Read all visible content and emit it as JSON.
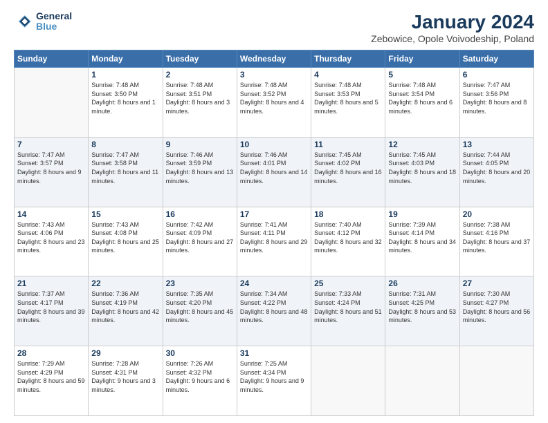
{
  "header": {
    "logo_line1": "General",
    "logo_line2": "Blue",
    "title": "January 2024",
    "subtitle": "Zebowice, Opole Voivodeship, Poland"
  },
  "weekdays": [
    "Sunday",
    "Monday",
    "Tuesday",
    "Wednesday",
    "Thursday",
    "Friday",
    "Saturday"
  ],
  "weeks": [
    [
      {
        "day": "",
        "sunrise": "",
        "sunset": "",
        "daylight": ""
      },
      {
        "day": "1",
        "sunrise": "Sunrise: 7:48 AM",
        "sunset": "Sunset: 3:50 PM",
        "daylight": "Daylight: 8 hours and 1 minute."
      },
      {
        "day": "2",
        "sunrise": "Sunrise: 7:48 AM",
        "sunset": "Sunset: 3:51 PM",
        "daylight": "Daylight: 8 hours and 3 minutes."
      },
      {
        "day": "3",
        "sunrise": "Sunrise: 7:48 AM",
        "sunset": "Sunset: 3:52 PM",
        "daylight": "Daylight: 8 hours and 4 minutes."
      },
      {
        "day": "4",
        "sunrise": "Sunrise: 7:48 AM",
        "sunset": "Sunset: 3:53 PM",
        "daylight": "Daylight: 8 hours and 5 minutes."
      },
      {
        "day": "5",
        "sunrise": "Sunrise: 7:48 AM",
        "sunset": "Sunset: 3:54 PM",
        "daylight": "Daylight: 8 hours and 6 minutes."
      },
      {
        "day": "6",
        "sunrise": "Sunrise: 7:47 AM",
        "sunset": "Sunset: 3:56 PM",
        "daylight": "Daylight: 8 hours and 8 minutes."
      }
    ],
    [
      {
        "day": "7",
        "sunrise": "Sunrise: 7:47 AM",
        "sunset": "Sunset: 3:57 PM",
        "daylight": "Daylight: 8 hours and 9 minutes."
      },
      {
        "day": "8",
        "sunrise": "Sunrise: 7:47 AM",
        "sunset": "Sunset: 3:58 PM",
        "daylight": "Daylight: 8 hours and 11 minutes."
      },
      {
        "day": "9",
        "sunrise": "Sunrise: 7:46 AM",
        "sunset": "Sunset: 3:59 PM",
        "daylight": "Daylight: 8 hours and 13 minutes."
      },
      {
        "day": "10",
        "sunrise": "Sunrise: 7:46 AM",
        "sunset": "Sunset: 4:01 PM",
        "daylight": "Daylight: 8 hours and 14 minutes."
      },
      {
        "day": "11",
        "sunrise": "Sunrise: 7:45 AM",
        "sunset": "Sunset: 4:02 PM",
        "daylight": "Daylight: 8 hours and 16 minutes."
      },
      {
        "day": "12",
        "sunrise": "Sunrise: 7:45 AM",
        "sunset": "Sunset: 4:03 PM",
        "daylight": "Daylight: 8 hours and 18 minutes."
      },
      {
        "day": "13",
        "sunrise": "Sunrise: 7:44 AM",
        "sunset": "Sunset: 4:05 PM",
        "daylight": "Daylight: 8 hours and 20 minutes."
      }
    ],
    [
      {
        "day": "14",
        "sunrise": "Sunrise: 7:43 AM",
        "sunset": "Sunset: 4:06 PM",
        "daylight": "Daylight: 8 hours and 23 minutes."
      },
      {
        "day": "15",
        "sunrise": "Sunrise: 7:43 AM",
        "sunset": "Sunset: 4:08 PM",
        "daylight": "Daylight: 8 hours and 25 minutes."
      },
      {
        "day": "16",
        "sunrise": "Sunrise: 7:42 AM",
        "sunset": "Sunset: 4:09 PM",
        "daylight": "Daylight: 8 hours and 27 minutes."
      },
      {
        "day": "17",
        "sunrise": "Sunrise: 7:41 AM",
        "sunset": "Sunset: 4:11 PM",
        "daylight": "Daylight: 8 hours and 29 minutes."
      },
      {
        "day": "18",
        "sunrise": "Sunrise: 7:40 AM",
        "sunset": "Sunset: 4:12 PM",
        "daylight": "Daylight: 8 hours and 32 minutes."
      },
      {
        "day": "19",
        "sunrise": "Sunrise: 7:39 AM",
        "sunset": "Sunset: 4:14 PM",
        "daylight": "Daylight: 8 hours and 34 minutes."
      },
      {
        "day": "20",
        "sunrise": "Sunrise: 7:38 AM",
        "sunset": "Sunset: 4:16 PM",
        "daylight": "Daylight: 8 hours and 37 minutes."
      }
    ],
    [
      {
        "day": "21",
        "sunrise": "Sunrise: 7:37 AM",
        "sunset": "Sunset: 4:17 PM",
        "daylight": "Daylight: 8 hours and 39 minutes."
      },
      {
        "day": "22",
        "sunrise": "Sunrise: 7:36 AM",
        "sunset": "Sunset: 4:19 PM",
        "daylight": "Daylight: 8 hours and 42 minutes."
      },
      {
        "day": "23",
        "sunrise": "Sunrise: 7:35 AM",
        "sunset": "Sunset: 4:20 PM",
        "daylight": "Daylight: 8 hours and 45 minutes."
      },
      {
        "day": "24",
        "sunrise": "Sunrise: 7:34 AM",
        "sunset": "Sunset: 4:22 PM",
        "daylight": "Daylight: 8 hours and 48 minutes."
      },
      {
        "day": "25",
        "sunrise": "Sunrise: 7:33 AM",
        "sunset": "Sunset: 4:24 PM",
        "daylight": "Daylight: 8 hours and 51 minutes."
      },
      {
        "day": "26",
        "sunrise": "Sunrise: 7:31 AM",
        "sunset": "Sunset: 4:25 PM",
        "daylight": "Daylight: 8 hours and 53 minutes."
      },
      {
        "day": "27",
        "sunrise": "Sunrise: 7:30 AM",
        "sunset": "Sunset: 4:27 PM",
        "daylight": "Daylight: 8 hours and 56 minutes."
      }
    ],
    [
      {
        "day": "28",
        "sunrise": "Sunrise: 7:29 AM",
        "sunset": "Sunset: 4:29 PM",
        "daylight": "Daylight: 8 hours and 59 minutes."
      },
      {
        "day": "29",
        "sunrise": "Sunrise: 7:28 AM",
        "sunset": "Sunset: 4:31 PM",
        "daylight": "Daylight: 9 hours and 3 minutes."
      },
      {
        "day": "30",
        "sunrise": "Sunrise: 7:26 AM",
        "sunset": "Sunset: 4:32 PM",
        "daylight": "Daylight: 9 hours and 6 minutes."
      },
      {
        "day": "31",
        "sunrise": "Sunrise: 7:25 AM",
        "sunset": "Sunset: 4:34 PM",
        "daylight": "Daylight: 9 hours and 9 minutes."
      },
      {
        "day": "",
        "sunrise": "",
        "sunset": "",
        "daylight": ""
      },
      {
        "day": "",
        "sunrise": "",
        "sunset": "",
        "daylight": ""
      },
      {
        "day": "",
        "sunrise": "",
        "sunset": "",
        "daylight": ""
      }
    ]
  ]
}
